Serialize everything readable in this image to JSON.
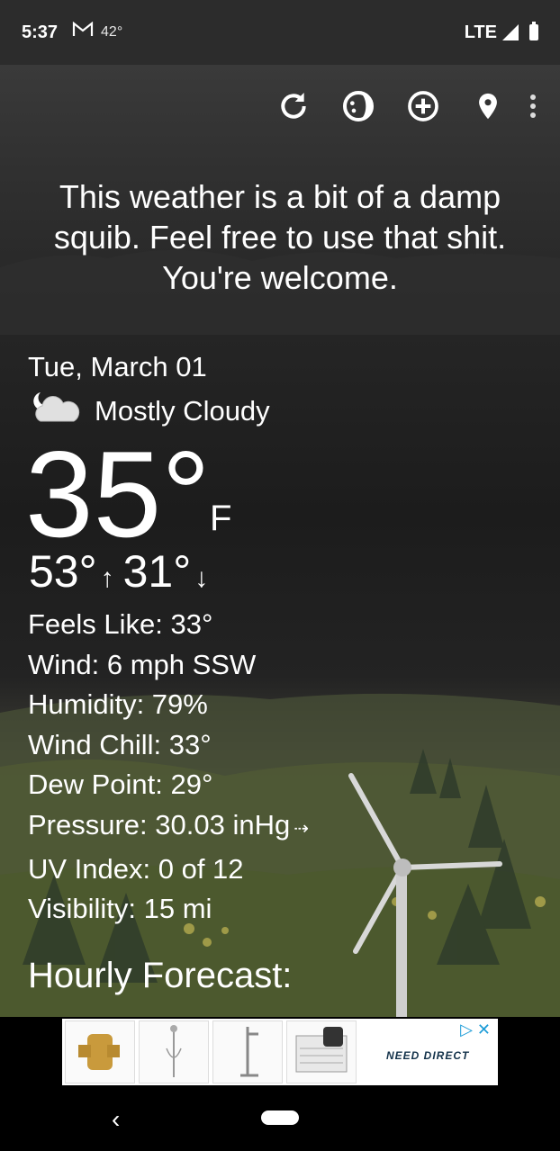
{
  "status": {
    "time": "5:37",
    "temp": "42°",
    "network": "LTE"
  },
  "toolbar": [
    "refresh-icon",
    "theme-icon",
    "add-location-icon",
    "location-pin-icon",
    "more-vert-icon"
  ],
  "quote": "This weather is a bit of a damp squib. Feel free to use that shit. You're welcome.",
  "weather": {
    "date": "Tue, March 01",
    "condition": "Mostly Cloudy",
    "temp": "35°",
    "unit": "F",
    "high": "53°",
    "low": "31°",
    "feels_like": "Feels Like:  33°",
    "wind": "Wind:  6 mph SSW",
    "humidity": "Humidity:  79%",
    "wind_chill": "Wind Chill:  33°",
    "dew_point": "Dew Point:  29°",
    "pressure": "Pressure:  30.03 inHg",
    "uv_index": "UV Index:  0 of 12",
    "visibility": "Visibility:  15 mi"
  },
  "hourly_title": "Hourly Forecast:",
  "ad": {
    "brand": "NEED DIRECT"
  },
  "colors": {
    "background": "#1e1e1e",
    "status_bar": "#2c2c2c",
    "ad_accent": "#1a9bd7"
  }
}
